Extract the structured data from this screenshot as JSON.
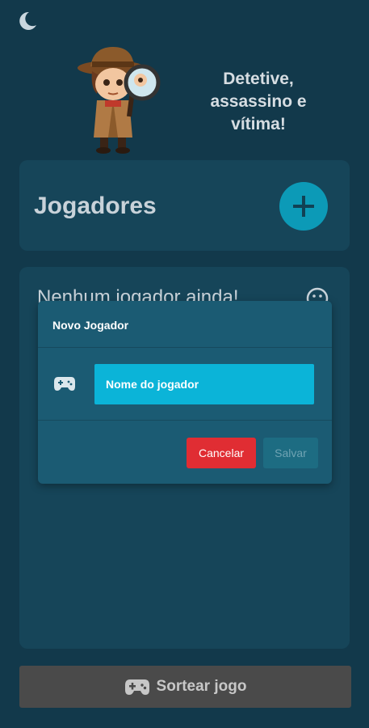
{
  "header": {
    "theme_icon": "moon-icon",
    "title": "Detetive, assassino e vítima!",
    "mascot": "detective-illustration"
  },
  "players": {
    "title": "Jogadores",
    "add_icon": "plus-icon",
    "empty_text": "Nenhum jogador ainda!",
    "empty_icon": "sad-face-icon"
  },
  "dialog": {
    "title": "Novo Jogador",
    "input_icon": "gamepad-icon",
    "input_placeholder": "Nome do jogador",
    "input_value": "",
    "cancel_label": "Cancelar",
    "save_label": "Salvar"
  },
  "footer": {
    "draw_label": "Sortear jogo",
    "draw_icon": "gamepad-icon"
  },
  "colors": {
    "background": "#12394b",
    "card": "#164559",
    "dialog": "#1b5b73",
    "accent": "#0bb4d8",
    "danger": "#e02d33",
    "disabled_button": "#4a4a4a"
  }
}
